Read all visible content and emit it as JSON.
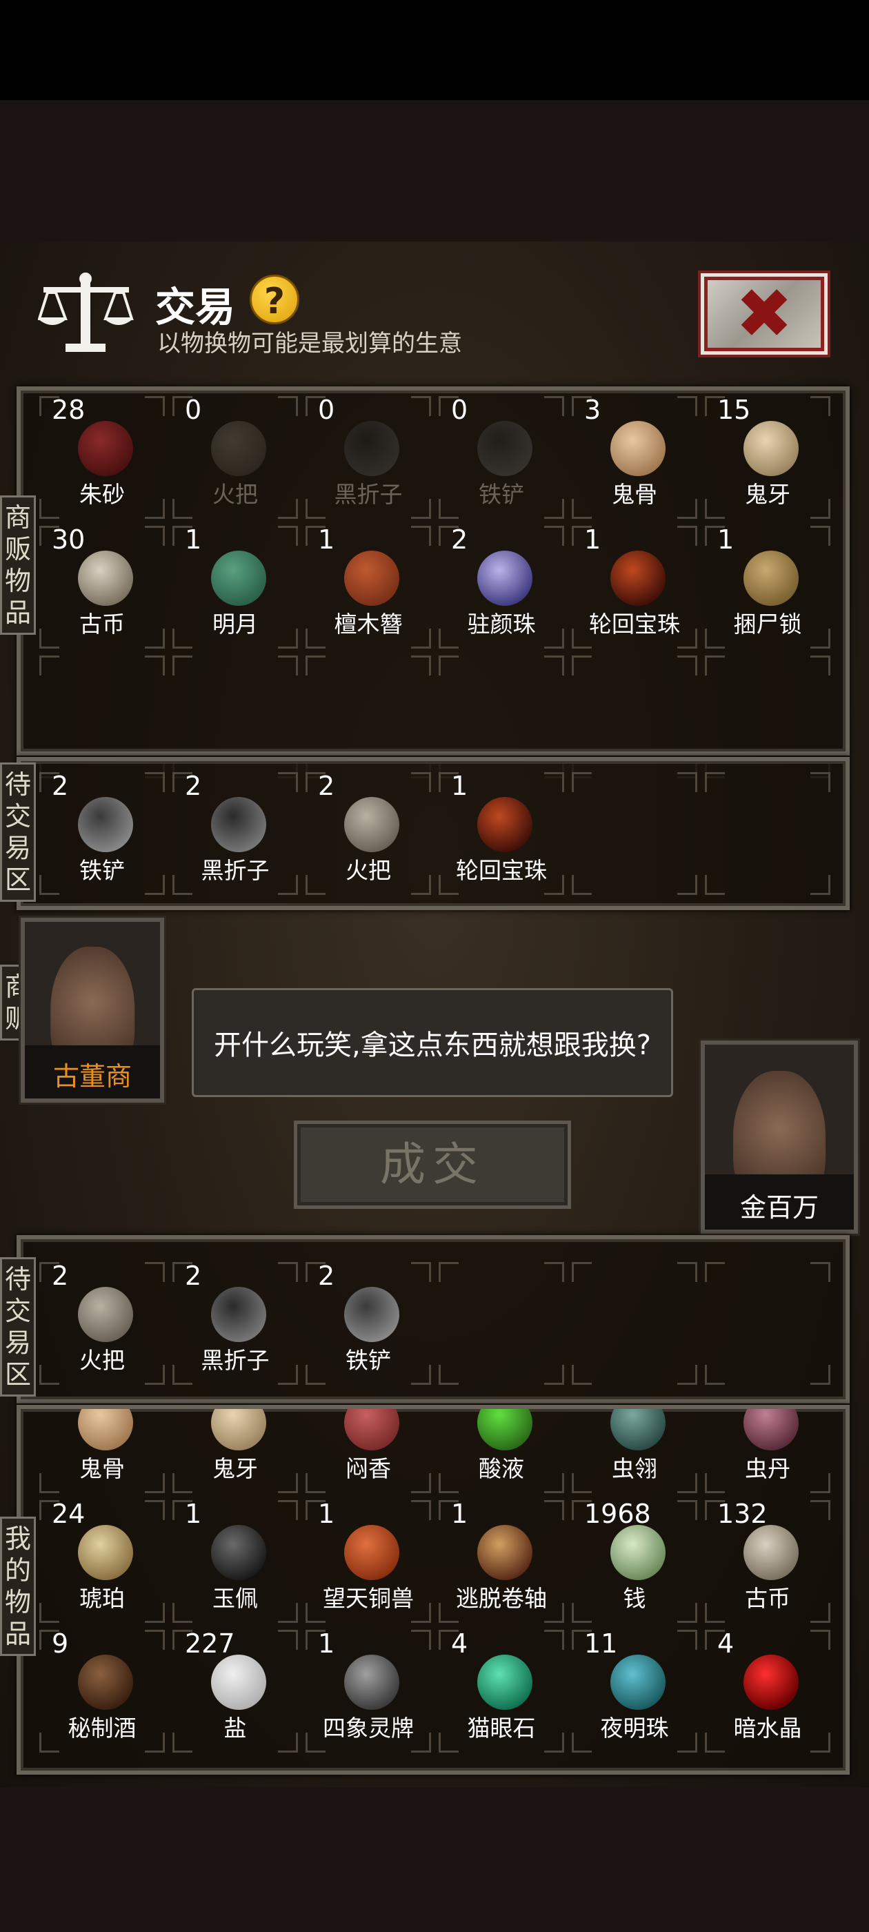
{
  "header": {
    "title": "交易",
    "help_label": "?",
    "subtitle": "以物换物可能是最划算的生意"
  },
  "labels": {
    "merchant_goods": [
      "商",
      "贩",
      "物",
      "品"
    ],
    "pending_trade": [
      "待",
      "交",
      "易",
      "区"
    ],
    "merchant": [
      "商",
      "贩"
    ],
    "my_goods": [
      "我",
      "的",
      "物",
      "品"
    ]
  },
  "merchant_inventory": [
    {
      "count": "28",
      "name": "朱砂",
      "icon": "cinnabar-icon",
      "dim": false
    },
    {
      "count": "0",
      "name": "火把",
      "icon": "torch-icon",
      "dim": true
    },
    {
      "count": "0",
      "name": "黑折子",
      "icon": "black-pick-icon",
      "dim": true
    },
    {
      "count": "0",
      "name": "铁铲",
      "icon": "iron-shovel-icon",
      "dim": true
    },
    {
      "count": "3",
      "name": "鬼骨",
      "icon": "ghost-bone-icon",
      "dim": false
    },
    {
      "count": "15",
      "name": "鬼牙",
      "icon": "ghost-tooth-icon",
      "dim": false
    },
    {
      "count": "30",
      "name": "古币",
      "icon": "ancient-coin-icon",
      "dim": false
    },
    {
      "count": "1",
      "name": "明月",
      "icon": "moon-pendant-icon",
      "dim": false
    },
    {
      "count": "1",
      "name": "檀木簪",
      "icon": "hairpin-icon",
      "dim": false
    },
    {
      "count": "2",
      "name": "驻颜珠",
      "icon": "youth-pearl-icon",
      "dim": false
    },
    {
      "count": "1",
      "name": "轮回宝珠",
      "icon": "reincarnation-orb-icon",
      "dim": false
    },
    {
      "count": "1",
      "name": "捆尸锁",
      "icon": "corpse-rope-icon",
      "dim": false
    }
  ],
  "merchant_pending": [
    {
      "count": "2",
      "name": "铁铲",
      "icon": "iron-shovel-icon"
    },
    {
      "count": "2",
      "name": "黑折子",
      "icon": "black-pick-icon"
    },
    {
      "count": "2",
      "name": "火把",
      "icon": "torch-icon"
    },
    {
      "count": "1",
      "name": "轮回宝珠",
      "icon": "reincarnation-orb-icon"
    }
  ],
  "merchant_npc": {
    "name": "古董商",
    "name_color": "#e8901c"
  },
  "player_npc": {
    "name": "金百万"
  },
  "dialog": "开什么玩笑,拿这点东西就想跟我换?",
  "deal_button": "成交",
  "player_pending": [
    {
      "count": "2",
      "name": "火把",
      "icon": "torch-icon"
    },
    {
      "count": "2",
      "name": "黑折子",
      "icon": "black-pick-icon"
    },
    {
      "count": "2",
      "name": "铁铲",
      "icon": "iron-shovel-icon"
    }
  ],
  "player_inventory": [
    {
      "count": "",
      "name": "鬼骨",
      "icon": "ghost-bone-icon"
    },
    {
      "count": "",
      "name": "鬼牙",
      "icon": "ghost-tooth-icon"
    },
    {
      "count": "",
      "name": "闷香",
      "icon": "incense-icon"
    },
    {
      "count": "",
      "name": "酸液",
      "icon": "acid-flask-icon"
    },
    {
      "count": "",
      "name": "虫翎",
      "icon": "insect-wing-icon"
    },
    {
      "count": "",
      "name": "虫丹",
      "icon": "insect-pill-icon"
    },
    {
      "count": "24",
      "name": "琥珀",
      "icon": "amber-icon"
    },
    {
      "count": "1",
      "name": "玉佩",
      "icon": "jade-pendant-icon"
    },
    {
      "count": "1",
      "name": "望天铜兽",
      "icon": "bronze-beast-icon"
    },
    {
      "count": "1",
      "name": "逃脱卷轴",
      "icon": "escape-scroll-icon"
    },
    {
      "count": "1968",
      "name": "钱",
      "icon": "money-stack-icon"
    },
    {
      "count": "132",
      "name": "古币",
      "icon": "ancient-coin-icon"
    },
    {
      "count": "9",
      "name": "秘制酒",
      "icon": "wine-jar-icon"
    },
    {
      "count": "227",
      "name": "盐",
      "icon": "salt-pile-icon"
    },
    {
      "count": "1",
      "name": "四象灵牌",
      "icon": "spirit-tablet-icon"
    },
    {
      "count": "4",
      "name": "猫眼石",
      "icon": "cats-eye-stone-icon"
    },
    {
      "count": "11",
      "name": "夜明珠",
      "icon": "night-pearl-icon"
    },
    {
      "count": "4",
      "name": "暗水晶",
      "icon": "dark-crystal-icon"
    }
  ]
}
